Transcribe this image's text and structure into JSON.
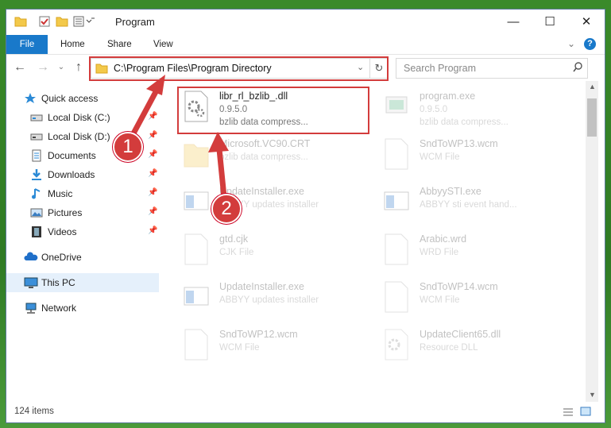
{
  "window": {
    "title": "Program",
    "controls": {
      "minimize": "—",
      "maximize": "☐",
      "close": "✕"
    }
  },
  "ribbon": {
    "tabs": [
      "File",
      "Home",
      "Share",
      "View"
    ]
  },
  "navigation": {
    "address": "C:\\Program Files\\Program Directory",
    "search_placeholder": "Search Program"
  },
  "sidebar": {
    "items": [
      {
        "label": "Quick access",
        "icon": "star-icon",
        "pinned": false
      },
      {
        "label": "Local Disk (C:)",
        "icon": "drive-icon",
        "pinned": true
      },
      {
        "label": "Local Disk (D:)",
        "icon": "drive-icon",
        "pinned": true
      },
      {
        "label": "Documents",
        "icon": "documents-icon",
        "pinned": true
      },
      {
        "label": "Downloads",
        "icon": "download-icon",
        "pinned": true
      },
      {
        "label": "Music",
        "icon": "music-icon",
        "pinned": true
      },
      {
        "label": "Pictures",
        "icon": "pictures-icon",
        "pinned": true
      },
      {
        "label": "Videos",
        "icon": "videos-icon",
        "pinned": true
      },
      {
        "label": "OneDrive",
        "icon": "cloud-icon",
        "pinned": false
      },
      {
        "label": "This PC",
        "icon": "computer-icon",
        "pinned": false,
        "selected": true
      },
      {
        "label": "Network",
        "icon": "network-icon",
        "pinned": false
      }
    ]
  },
  "files": [
    {
      "name": "libr_rl_bzlib_.dll",
      "line2": "0.9.5.0",
      "line3": "bzlib data compress...",
      "icon": "dll-gear-icon",
      "highlight": true
    },
    {
      "name": "program.exe",
      "line2": "0.9.5.0",
      "line3": "bzlib data compress...",
      "icon": "exe-icon"
    },
    {
      "name": "Microsoft.VC90.CRT",
      "line2": "bzlib data compress...",
      "icon": "folder-icon"
    },
    {
      "name": "SndToWP13.wcm",
      "line2": "WCM File",
      "icon": "blank-file-icon"
    },
    {
      "name": "UpdateInstaller.exe",
      "line2": "ABBYY updates installer",
      "icon": "window-app-icon"
    },
    {
      "name": "AbbyySTI.exe",
      "line2": "ABBYY sti event hand...",
      "icon": "window-app-icon"
    },
    {
      "name": "gtd.cjk",
      "line2": "CJK File",
      "icon": "blank-file-icon"
    },
    {
      "name": "Arabic.wrd",
      "line2": "WRD File",
      "icon": "blank-file-icon"
    },
    {
      "name": "UpdateInstaller.exe",
      "line2": "ABBYY updates installer",
      "icon": "window-app-icon"
    },
    {
      "name": "SndToWP14.wcm",
      "line2": "WCM File",
      "icon": "blank-file-icon"
    },
    {
      "name": "SndToWP12.wcm",
      "line2": "WCM File",
      "icon": "blank-file-icon"
    },
    {
      "name": "UpdateClient65.dll",
      "line2": "Resource DLL",
      "icon": "dll-gear-icon"
    }
  ],
  "status": {
    "item_count": "124 items"
  },
  "annotations": {
    "step1": "1",
    "step2": "2",
    "color": "#d33c3c"
  }
}
